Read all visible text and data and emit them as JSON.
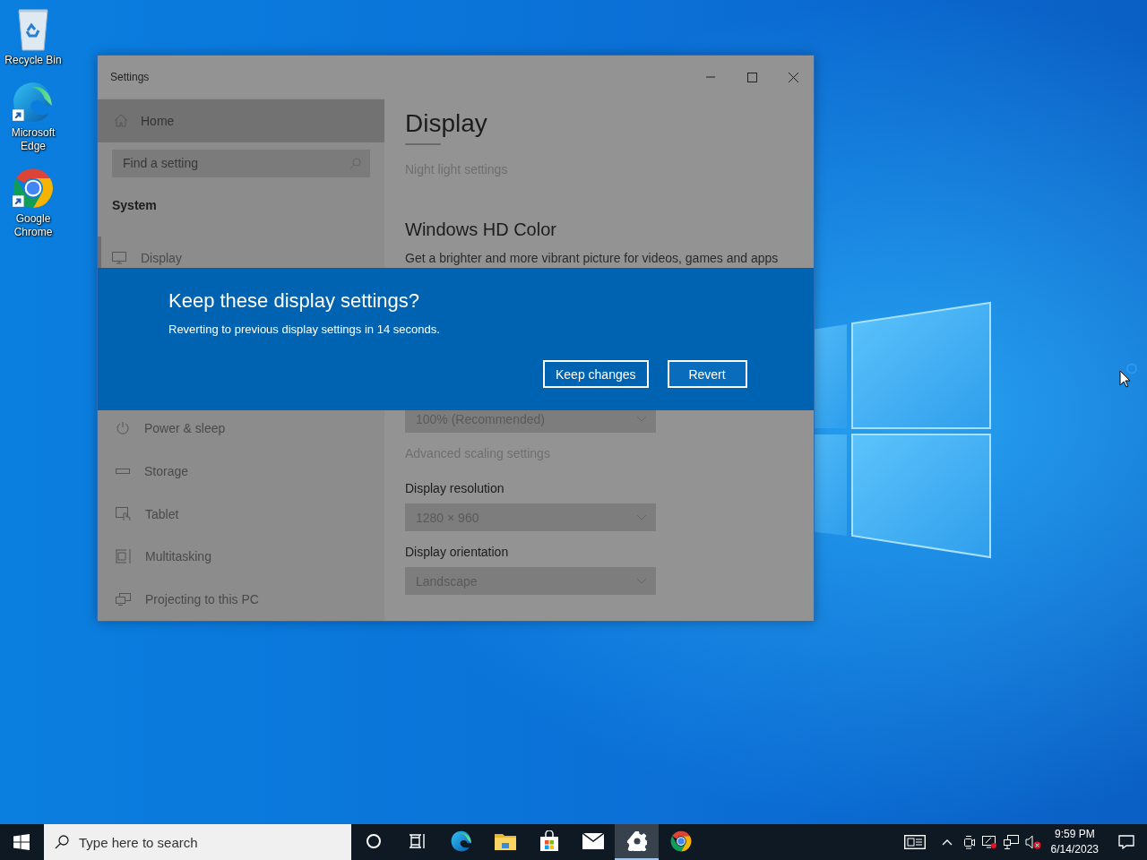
{
  "desktop": {
    "icons": [
      {
        "label": "Recycle Bin",
        "kind": "recycle",
        "shortcut": false
      },
      {
        "label": "Microsoft Edge",
        "kind": "edge",
        "shortcut": true
      },
      {
        "label": "Google Chrome",
        "kind": "chrome",
        "shortcut": true
      }
    ]
  },
  "settings_window": {
    "title": "Settings",
    "sidebar": {
      "home": "Home",
      "search": {
        "placeholder": "Find a setting"
      },
      "section": "System",
      "items": [
        {
          "label": "Display",
          "kind": "display",
          "selected": true
        },
        {
          "label": "Power & sleep",
          "kind": "power",
          "selected": false
        },
        {
          "label": "Storage",
          "kind": "storage",
          "selected": false
        },
        {
          "label": "Tablet",
          "kind": "tablet",
          "selected": false
        },
        {
          "label": "Multitasking",
          "kind": "multitasking",
          "selected": false
        },
        {
          "label": "Projecting to this PC",
          "kind": "projecting",
          "selected": false
        }
      ]
    },
    "content": {
      "heading": "Display",
      "night_light_link": "Night light settings",
      "hd_color_heading": "Windows HD Color",
      "hd_color_description": "Get a brighter and more vibrant picture for videos, games and apps",
      "scale_dropdown": {
        "value": "100% (Recommended)"
      },
      "advanced_scaling_link": "Advanced scaling settings",
      "fields": [
        {
          "label": "Display resolution",
          "value": "1280 × 960"
        },
        {
          "label": "Display orientation",
          "value": "Landscape"
        }
      ]
    }
  },
  "dialog": {
    "title": "Keep these display settings?",
    "message": "Reverting to previous display settings in 14 seconds.",
    "buttons": [
      {
        "label": "Keep changes"
      },
      {
        "label": "Revert"
      }
    ]
  },
  "taskbar": {
    "search": {
      "placeholder": "Type here to search"
    },
    "apps": [
      {
        "kind": "cortana",
        "active": false
      },
      {
        "kind": "taskview",
        "active": false
      },
      {
        "kind": "edge",
        "active": false
      },
      {
        "kind": "explorer",
        "active": false
      },
      {
        "kind": "store",
        "active": false
      },
      {
        "kind": "mail",
        "active": false
      },
      {
        "kind": "settings",
        "active": true
      },
      {
        "kind": "chrome",
        "active": false
      }
    ],
    "tray": [
      {
        "kind": "news"
      },
      {
        "kind": "chevron"
      },
      {
        "kind": "meet"
      },
      {
        "kind": "display-alert"
      },
      {
        "kind": "network"
      },
      {
        "kind": "volume-muted"
      }
    ],
    "time": "9:59 PM",
    "date": "6/14/2023"
  }
}
